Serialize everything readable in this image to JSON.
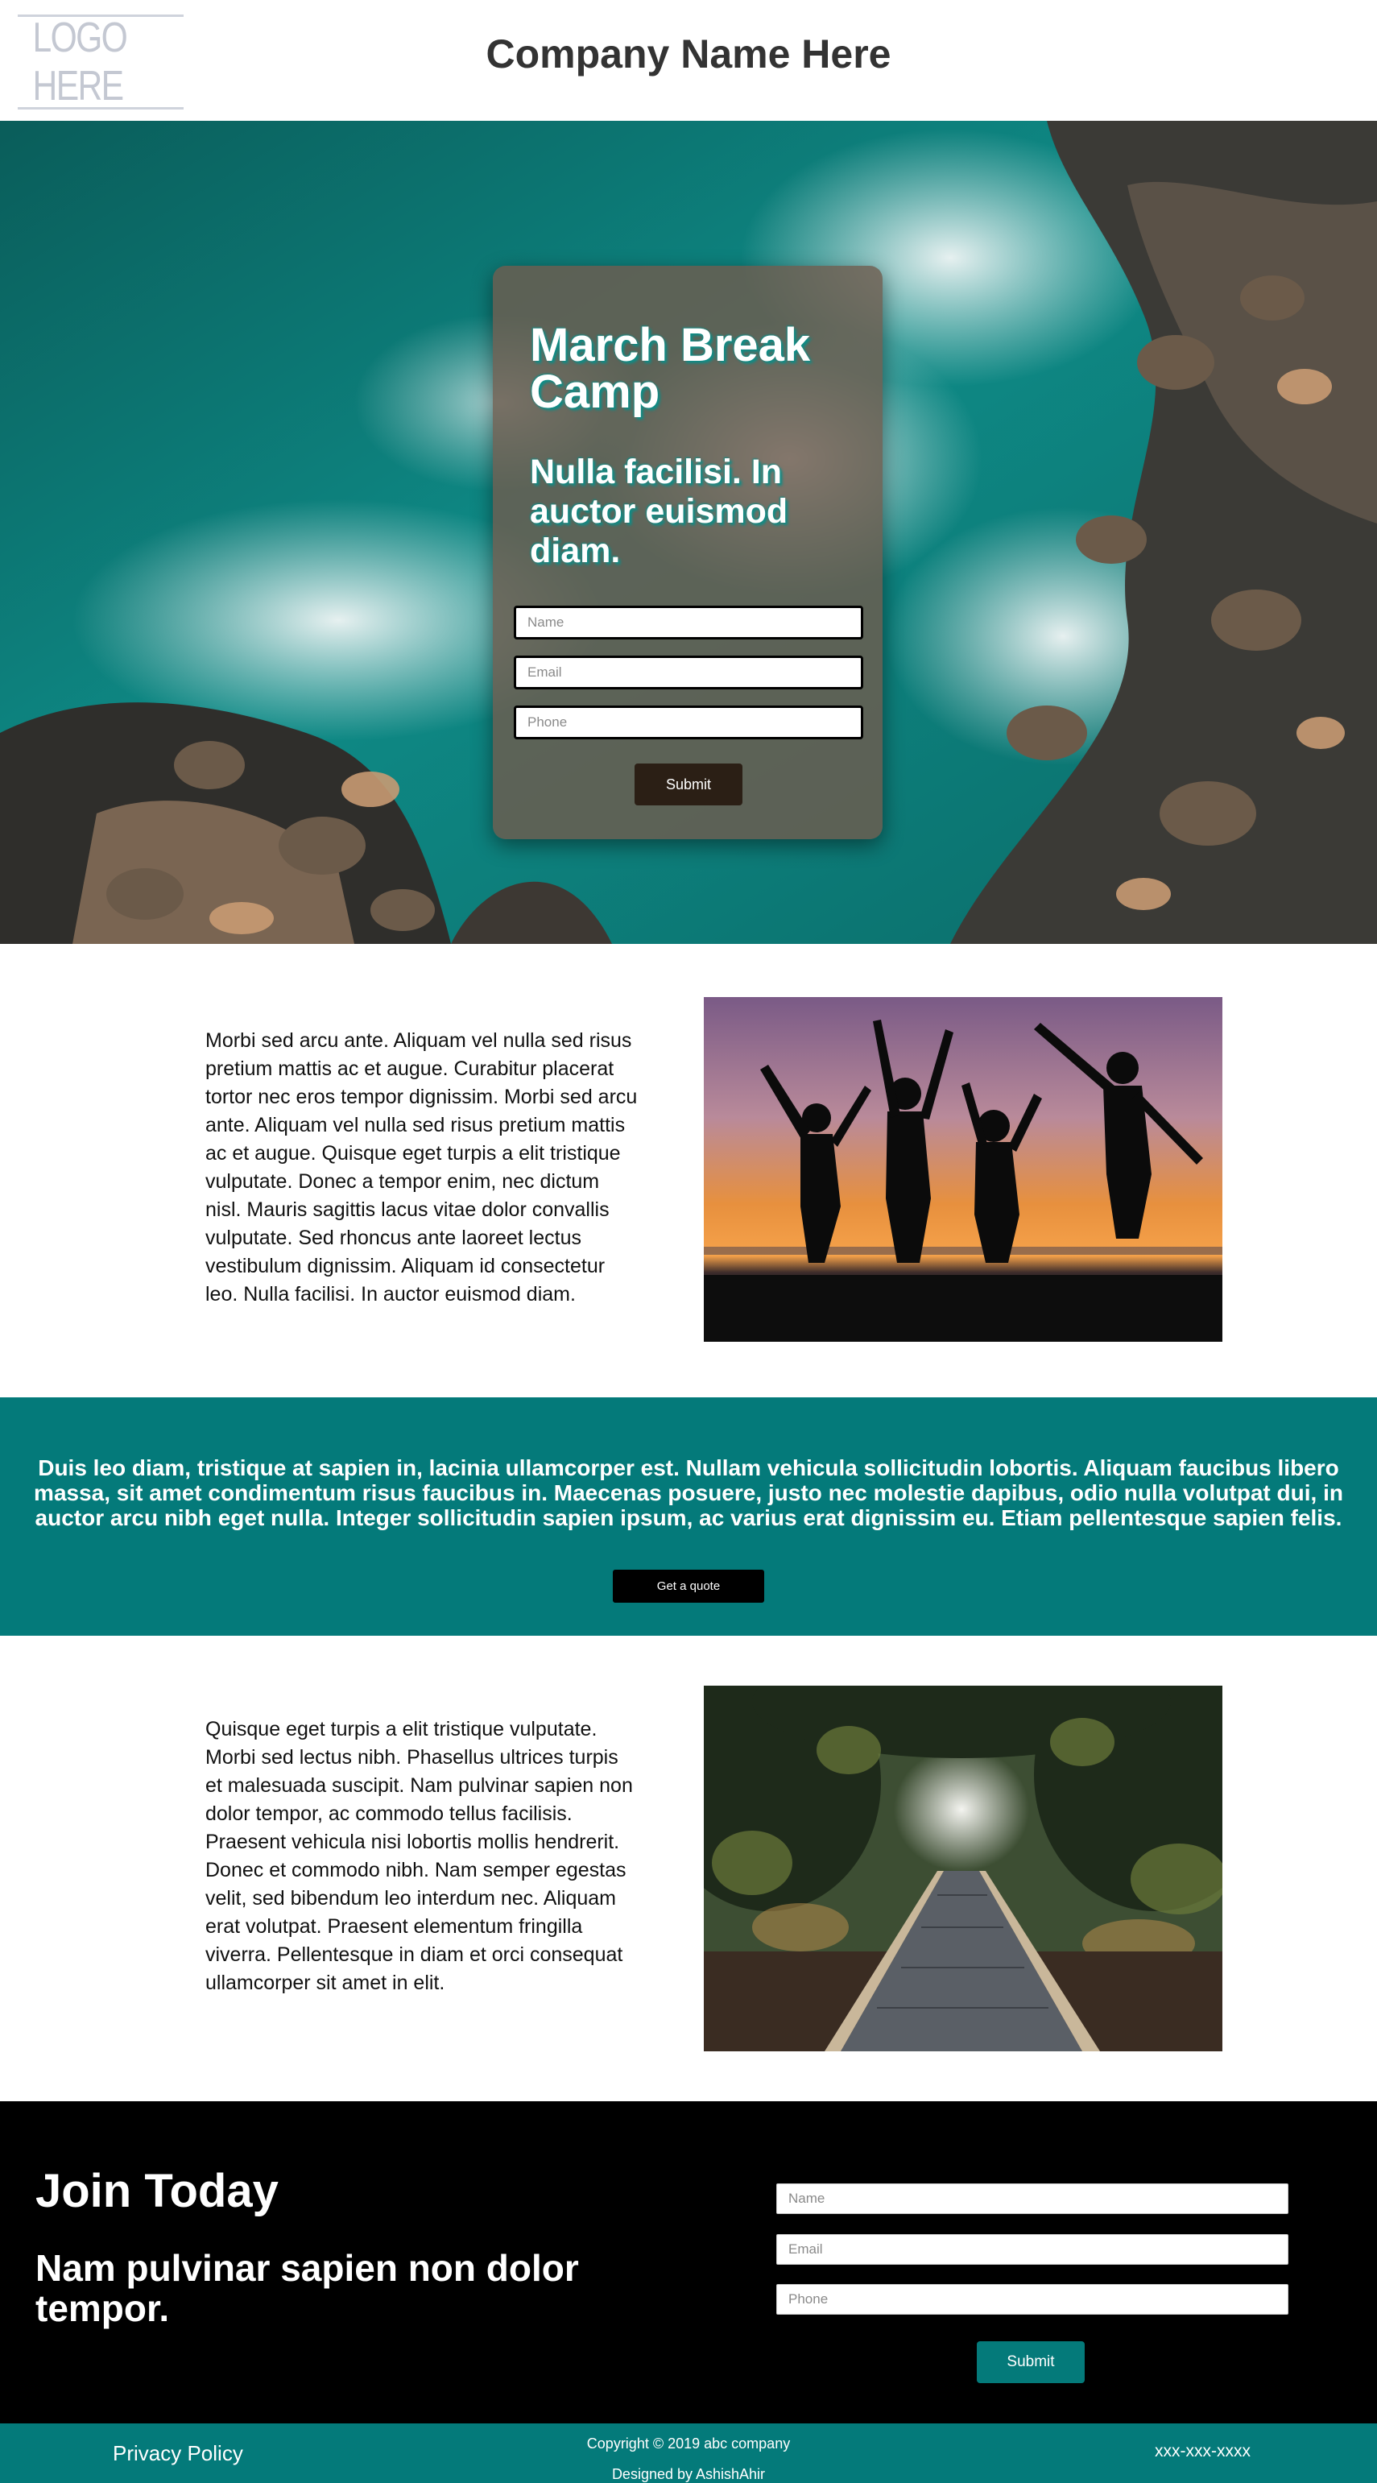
{
  "header": {
    "logo_text": "LOGO HERE",
    "company_name": "Company Name Here"
  },
  "hero": {
    "title": "March Break Camp",
    "subtitle": "Nulla facilisi. In auctor euismod diam.",
    "form": {
      "name_placeholder": "Name",
      "email_placeholder": "Email",
      "phone_placeholder": "Phone",
      "submit_label": "Submit"
    }
  },
  "section1": {
    "paragraph": "Morbi sed arcu ante. Aliquam vel nulla sed risus pretium mattis ac et augue. Curabitur placerat tortor nec eros tempor dignissim. Morbi sed arcu ante. Aliquam vel nulla sed risus pretium mattis ac et augue. Quisque eget turpis a elit tristique vulputate. Donec a tempor enim, nec dictum nisl. Mauris sagittis lacus vitae dolor convallis vulputate. Sed rhoncus ante laoreet lectus vestibulum dignissim. Aliquam id consectetur leo. Nulla facilisi. In auctor euismod diam."
  },
  "band": {
    "text": "Duis leo diam, tristique at sapien in, lacinia ullamcorper est. Nullam vehicula sollicitudin lobortis. Aliquam faucibus libero massa, sit amet condimentum risus faucibus in. Maecenas posuere, justo nec molestie dapibus, odio nulla volutpat dui, in auctor arcu nibh eget nulla. Integer sollicitudin sapien ipsum, ac varius erat dignissim eu. Etiam pellentesque sapien felis.",
    "button_label": "Get a quote"
  },
  "section2": {
    "paragraph": "Quisque eget turpis a elit tristique vulputate. Morbi sed lectus nibh. Phasellus ultrices turpis et malesuada suscipit. Nam pulvinar sapien non dolor tempor, ac commodo tellus facilisis. Praesent vehicula nisi lobortis mollis hendrerit. Donec et commodo nibh. Nam semper egestas velit, sed bibendum leo interdum nec. Aliquam erat volutpat. Praesent elementum fringilla viverra. Pellentesque in diam et orci consequat ullamcorper sit amet in elit."
  },
  "join": {
    "title": "Join Today",
    "subtitle": "Nam pulvinar sapien non dolor tempor.",
    "form": {
      "name_placeholder": "Name",
      "email_placeholder": "Email",
      "phone_placeholder": "Phone",
      "submit_label": "Submit"
    }
  },
  "footer": {
    "privacy": "Privacy Policy",
    "copyright": "Copyright © 2019 abc company",
    "designed_by": "Designed by AshishAhir",
    "phone": "xxx-xxx-xxxx"
  },
  "colors": {
    "teal": "#047a7a",
    "heading_dark": "#333333",
    "black": "#000000"
  }
}
